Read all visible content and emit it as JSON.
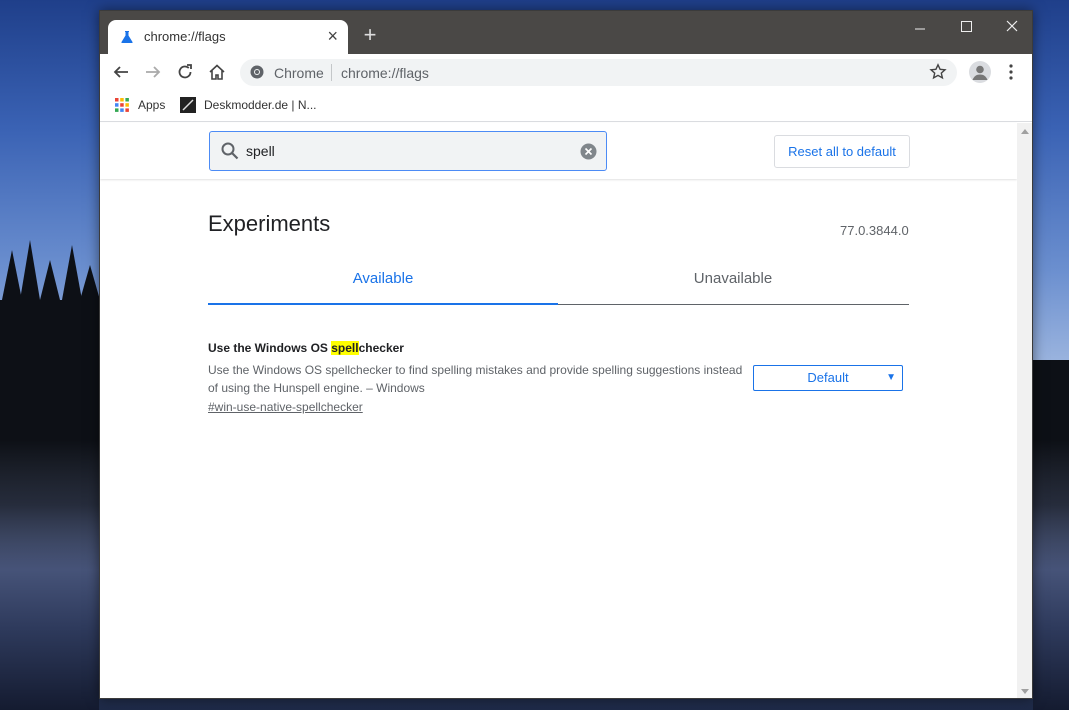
{
  "tab": {
    "title": "chrome://flags",
    "close": "×"
  },
  "new_tab": "+",
  "omnibox": {
    "chrome_label": "Chrome",
    "url": "chrome://flags"
  },
  "bookmarks": [
    {
      "label": "Apps"
    },
    {
      "label": "Deskmodder.de | N..."
    }
  ],
  "search": {
    "value": "spell"
  },
  "reset_label": "Reset all to default",
  "heading": "Experiments",
  "version": "77.0.3844.0",
  "tabs": [
    {
      "label": "Available"
    },
    {
      "label": "Unavailable"
    }
  ],
  "flag": {
    "title_before": "Use the Windows OS ",
    "title_highlight": "spell",
    "title_after": "checker",
    "description": "Use the Windows OS spellchecker to find spelling mistakes and provide spelling suggestions instead of using the Hunspell engine. – Windows",
    "link": "#win-use-native-spellchecker",
    "select_value": "Default"
  },
  "colors": {
    "accent": "#1a73e8",
    "highlight": "#ffff00",
    "titlebar": "#4a4846"
  }
}
